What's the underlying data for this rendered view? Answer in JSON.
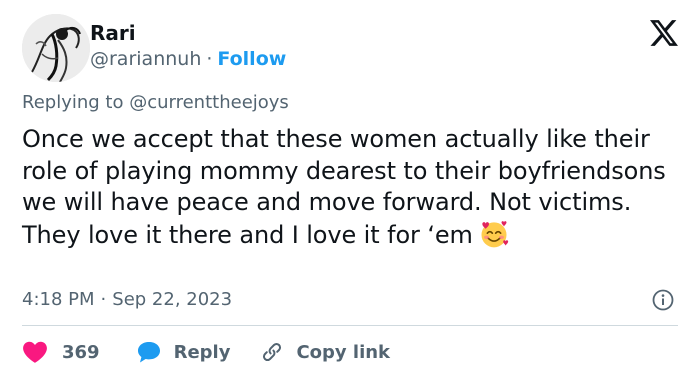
{
  "author": {
    "name": "Rari",
    "handle": "@rariannuh",
    "separator": "·",
    "follow_label": "Follow"
  },
  "platform_logo": "x-logo-icon",
  "reply_context": {
    "prefix": "Replying to",
    "mention": "@currenttheejoys"
  },
  "tweet": {
    "text": "Once we accept that these women actually like their role of playing mommy dearest to their boyfriendsons we will have peace and move forward. Not victims. They love it there and I love it for ‘em",
    "emoji": "smiling-face-with-hearts-emoji"
  },
  "meta": {
    "time": "4:18 PM",
    "separator": "·",
    "date": "Sep 22, 2023"
  },
  "actions": {
    "like_count": "369",
    "reply_label": "Reply",
    "copy_label": "Copy link"
  },
  "colors": {
    "accent": "#1d9bf0",
    "like": "#f91880",
    "muted": "#536471",
    "text": "#0f1419",
    "divider": "#cfd9de"
  }
}
